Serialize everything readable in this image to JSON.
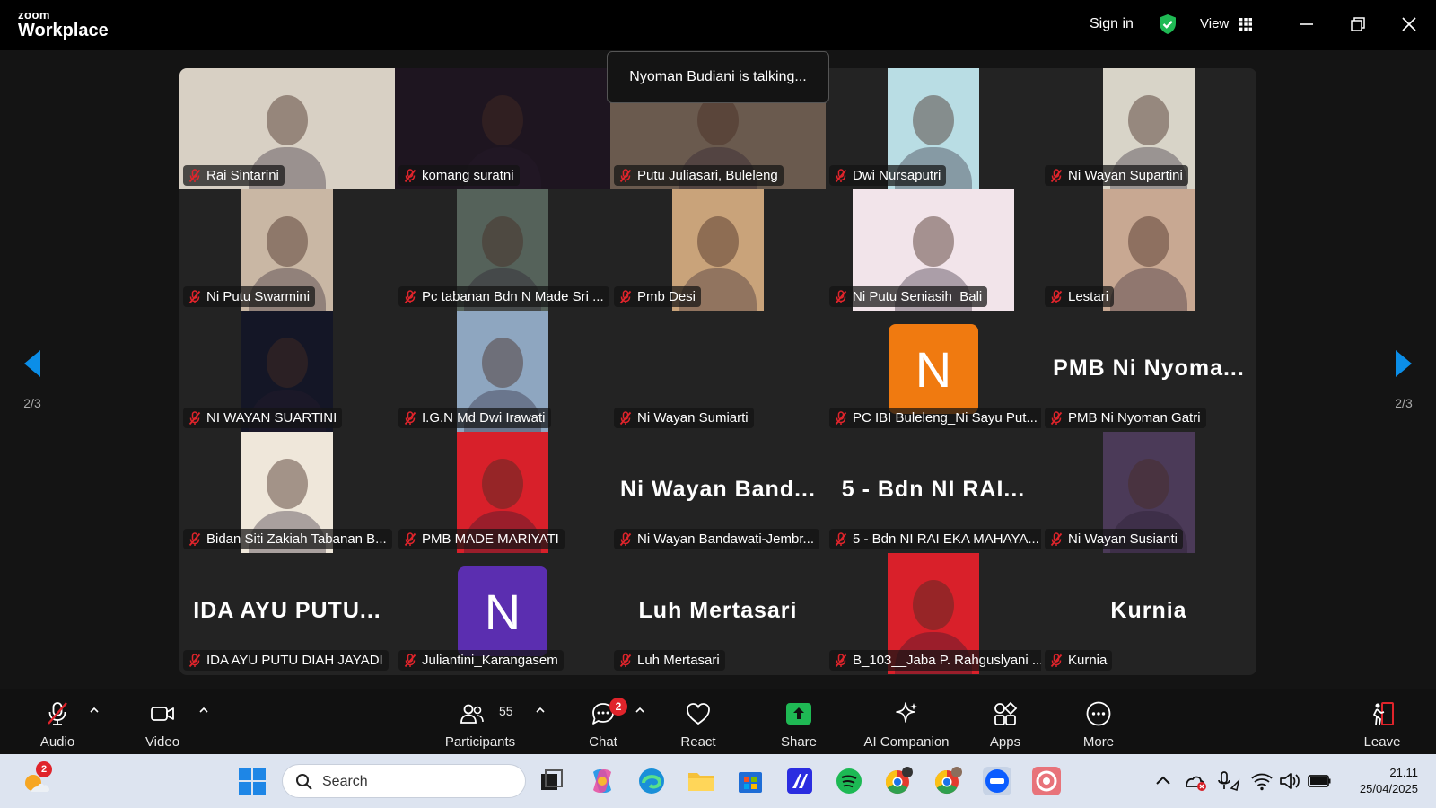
{
  "titlebar": {
    "logo_top": "zoom",
    "logo_bottom": "Workplace",
    "sign_in": "Sign in",
    "view": "View"
  },
  "talking_banner": "Nyoman Budiani is talking...",
  "pagination": {
    "left": "2/3",
    "right": "2/3"
  },
  "participants": [
    {
      "name": "Rai Sintarini",
      "type": "video",
      "video_color": "#d8d0c4"
    },
    {
      "name": "komang suratni",
      "type": "video",
      "video_color": "#1e1520"
    },
    {
      "name": "Putu Juliasari,  Buleleng",
      "type": "video",
      "video_color": "#6a5a4e"
    },
    {
      "name": "Dwi Nursaputri",
      "type": "video",
      "video_color": "#b9dde4",
      "narrow": true
    },
    {
      "name": "Ni Wayan Supartini",
      "type": "video",
      "video_color": "#d8d4c8",
      "narrow": true
    },
    {
      "name": "Ni Putu Swarmini",
      "type": "video",
      "video_color": "#c9b7a4",
      "narrow": true
    },
    {
      "name": "Pc tabanan Bdn N Made Sri ...",
      "type": "video",
      "video_color": "#55625a",
      "narrow": true
    },
    {
      "name": "Pmb Desi",
      "type": "video",
      "video_color": "#c9a37a",
      "narrow": true
    },
    {
      "name": "Ni Putu Seniasih_Bali",
      "type": "video",
      "video_color": "#f2e4ea",
      "wide": true
    },
    {
      "name": "Lestari",
      "type": "video",
      "video_color": "#c8a892",
      "narrow": true
    },
    {
      "name": "NI WAYAN SUARTINI",
      "type": "video",
      "video_color": "#141626",
      "narrow": true
    },
    {
      "name": "I.G.N Md Dwi Irawati",
      "type": "video",
      "video_color": "#8ea6c0",
      "narrow": true
    },
    {
      "name": "Ni Wayan Sumiarti",
      "type": "blank"
    },
    {
      "name": "PC IBI Buleleng_Ni Sayu Put...",
      "type": "avatar",
      "letter": "N",
      "color": "#f07a10"
    },
    {
      "name": "PMB Ni Nyoman Gatri",
      "type": "text",
      "display": "PMB Ni Nyoma..."
    },
    {
      "name": "Bidan Siti Zakiah Tabanan B...",
      "type": "video",
      "video_color": "#efe7da",
      "narrow": true
    },
    {
      "name": "PMB MADE MARIYATI",
      "type": "video",
      "video_color": "#d8202a",
      "narrow": true
    },
    {
      "name": "Ni Wayan Bandawati-Jembr...",
      "type": "text",
      "display": "Ni Wayan Band..."
    },
    {
      "name": "5 - Bdn NI RAI EKA MAHAYA...",
      "type": "text",
      "display": "5 - Bdn NI RAI..."
    },
    {
      "name": "Ni Wayan Susianti",
      "type": "video",
      "video_color": "#4b3a58",
      "narrow": true
    },
    {
      "name": "IDA AYU PUTU DIAH JAYADI",
      "type": "text",
      "display": "IDA AYU PUTU..."
    },
    {
      "name": "Juliantini_Karangasem",
      "type": "avatar",
      "letter": "N",
      "color": "#5b2eb0"
    },
    {
      "name": "Luh Mertasari",
      "type": "text",
      "display": "Luh Mertasari"
    },
    {
      "name": "B_103__Jaba P. Rahguslyani ...",
      "type": "video",
      "video_color": "#d9202a",
      "narrow": true
    },
    {
      "name": "Kurnia",
      "type": "text",
      "display": "Kurnia"
    }
  ],
  "toolbar": {
    "audio": "Audio",
    "video": "Video",
    "participants": "Participants",
    "participants_count": "55",
    "chat": "Chat",
    "chat_badge": "2",
    "react": "React",
    "share": "Share",
    "ai_companion": "AI Companion",
    "apps": "Apps",
    "more": "More",
    "leave": "Leave"
  },
  "taskbar": {
    "weather_badge": "2",
    "search_placeholder": "Search",
    "time": "21.11",
    "date": "25/04/2025"
  },
  "colors": {
    "accent_blue": "#0b8ee8",
    "secure_green": "#1fb954",
    "share_green": "#1fb954",
    "muted_red": "#e0242b"
  }
}
